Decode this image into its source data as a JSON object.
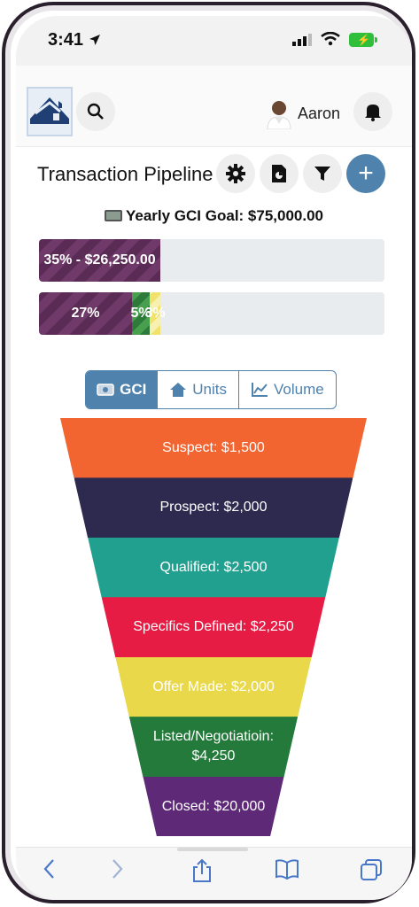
{
  "status_bar": {
    "time": "3:41"
  },
  "header": {
    "user_name": "Aaron"
  },
  "toolbar": {
    "title": "Transaction Pipeline",
    "add_label": "+"
  },
  "goal": {
    "text": "Yearly GCI Goal: $75,000.00"
  },
  "progress": {
    "bar1": {
      "fraction": 0.35,
      "label": "35% - $26,250.00"
    },
    "bar2": [
      {
        "fraction": 0.27,
        "label": "27%",
        "color": "#5a2b55"
      },
      {
        "fraction": 0.05,
        "label": "5%",
        "color": "#2d7a3a"
      },
      {
        "fraction": 0.03,
        "label": "3%",
        "color": "#f0e26a"
      }
    ]
  },
  "segmented": {
    "options": [
      {
        "label": "GCI",
        "icon": "money-icon",
        "selected": true
      },
      {
        "label": "Units",
        "icon": "house-icon",
        "selected": false
      },
      {
        "label": "Volume",
        "icon": "chart-icon",
        "selected": false
      }
    ]
  },
  "funnel": {
    "stages": [
      {
        "label": "Suspect: $1,500",
        "color": "#f26531"
      },
      {
        "label": "Prospect: $2,000",
        "color": "#2e2a4f"
      },
      {
        "label": "Qualified: $2,500",
        "color": "#22a08f"
      },
      {
        "label": "Specifics Defined: $2,250",
        "color": "#e61c44"
      },
      {
        "label": "Offer Made: $2,000",
        "color": "#e8d84a"
      },
      {
        "label": "Listed/Negotiatioin: $4,250",
        "color": "#237a3b"
      },
      {
        "label": "Closed: $20,000",
        "color": "#5e2a78"
      }
    ]
  },
  "colors": {
    "accent": "#4f82ad"
  }
}
